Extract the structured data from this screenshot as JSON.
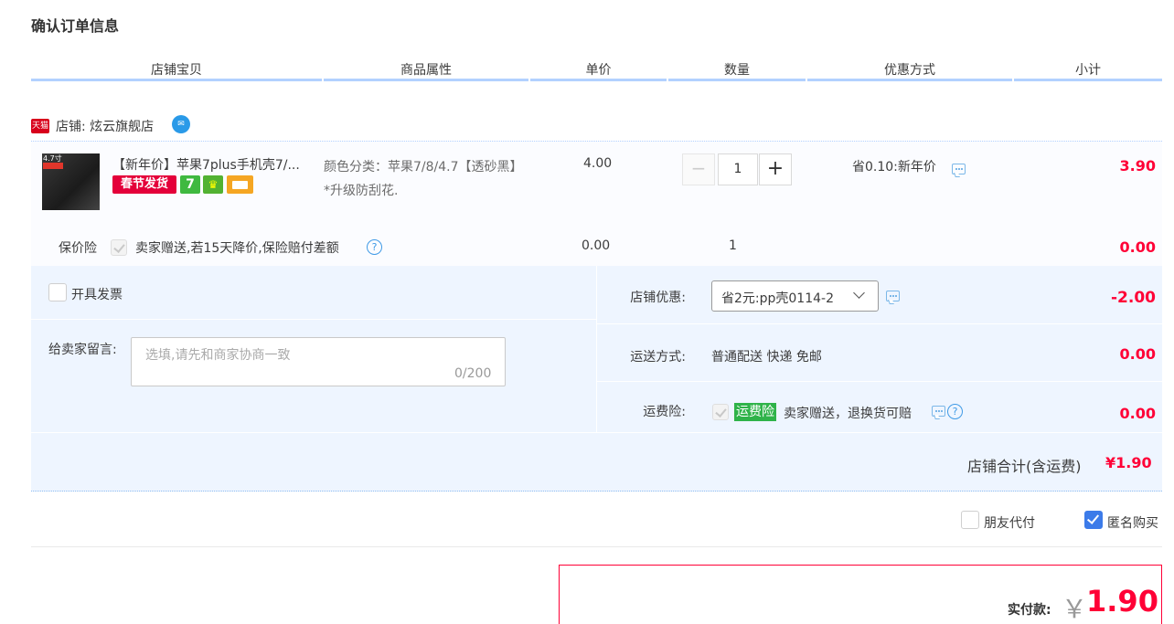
{
  "page_title": "确认订单信息",
  "columns": [
    "店铺宝贝",
    "商品属性",
    "单价",
    "数量",
    "优惠方式",
    "小计"
  ],
  "shop": {
    "badge": "天猫",
    "label": "店铺: 炫云旗舰店"
  },
  "item": {
    "thumb_tag": "4.7寸",
    "title": "【新年价】苹果7plus手机壳7/...",
    "tag_chunjie": "春节发货",
    "tag_7": "7",
    "attr": "颜色分类：苹果7/8/4.7【透砂黑】*升级防刮花.",
    "price": "4.00",
    "quantity": "1",
    "minus": "−",
    "plus": "+",
    "promo": "省0.10:新年价",
    "subtotal": "3.90"
  },
  "insurance": {
    "label": "保价险",
    "desc": "卖家赠送,若15天降价,保险赔付差额",
    "price": "0.00",
    "quantity": "1",
    "subtotal": "0.00"
  },
  "invoice": {
    "label": "开具发票"
  },
  "message": {
    "label": "给卖家留言:",
    "placeholder": "选填,请先和商家协商一致",
    "counter": "0/200"
  },
  "shop_discount": {
    "label": "店铺优惠:",
    "selected": "省2元:pp壳0114-2",
    "amount": "-2.00"
  },
  "shipping": {
    "label": "运送方式:",
    "value": "普通配送 快递 免邮",
    "amount": "0.00"
  },
  "shipping_insurance": {
    "label": "运费险:",
    "tag": "运费险",
    "desc": "卖家赠送，退换货可赔",
    "amount": "0.00"
  },
  "shop_total": {
    "label": "店铺合计(含运费)",
    "value": "¥1.90"
  },
  "options": {
    "friend_pay": "朋友代付",
    "anonymous": "匿名购买"
  },
  "payment": {
    "label": "实付款:",
    "currency": "￥",
    "amount": "1.90"
  },
  "colors": {
    "accent_red": "#ff0036",
    "header_line": "#b2d1ff",
    "panel_bg": "#eef5ff",
    "checkbox_blue": "#3c7be9",
    "freight_tag_green": "#2fb349"
  },
  "icons": [
    "tmall-icon",
    "wangwang-icon",
    "chat-icon",
    "help-icon",
    "chevron-down-icon"
  ]
}
